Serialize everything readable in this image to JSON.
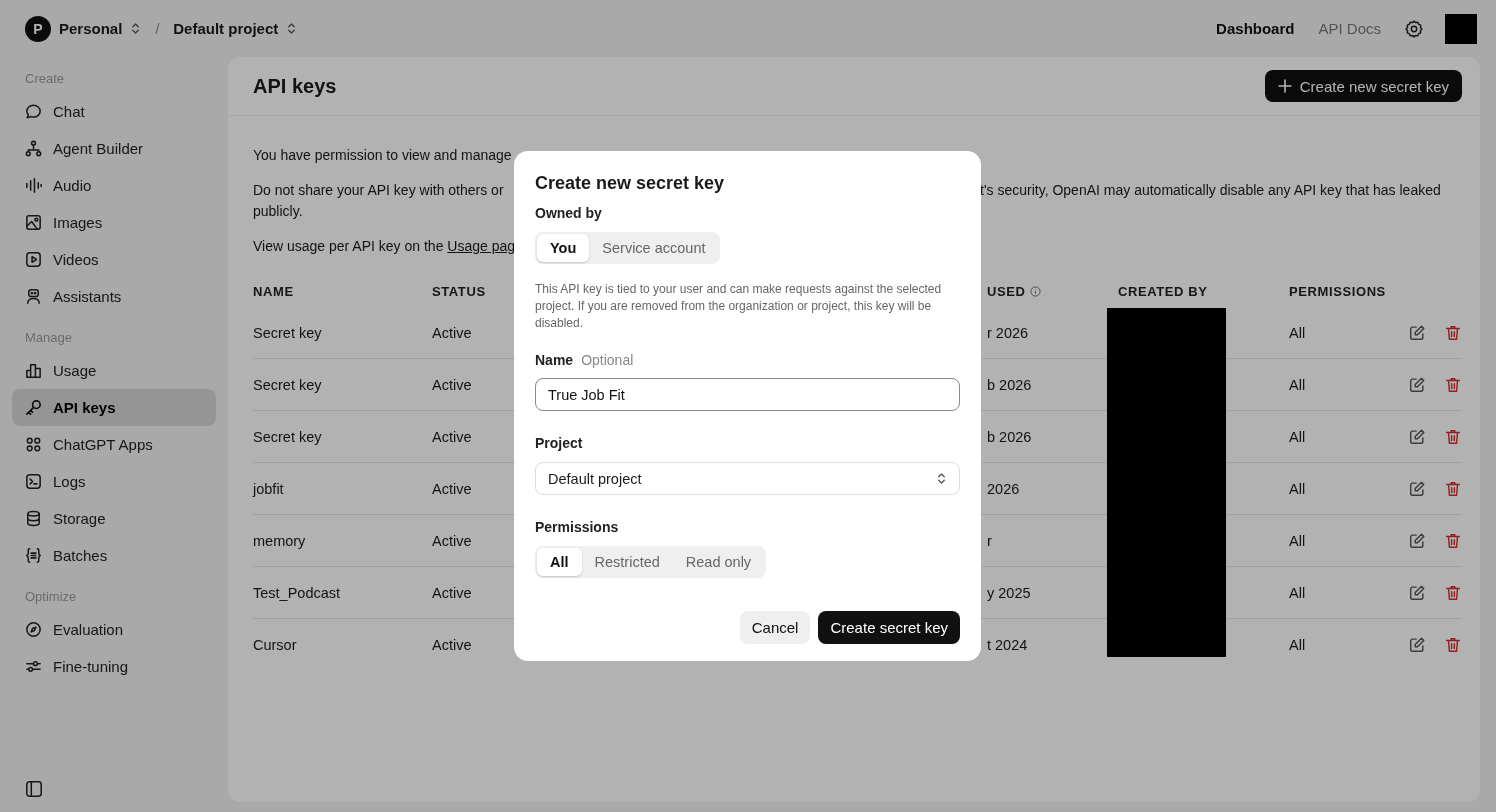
{
  "topbar": {
    "org": {
      "avatar_letter": "P",
      "name": "Personal"
    },
    "separator": "/",
    "project": "Default project",
    "nav": [
      {
        "label": "Dashboard",
        "selected": true
      },
      {
        "label": "API Docs",
        "selected": false
      }
    ]
  },
  "sidebar": {
    "sections": [
      {
        "title": "Create",
        "items": [
          {
            "label": "Chat",
            "kind": "chat",
            "selected": false
          },
          {
            "label": "Agent Builder",
            "kind": "agent",
            "selected": false
          },
          {
            "label": "Audio",
            "kind": "audio",
            "selected": false
          },
          {
            "label": "Images",
            "kind": "images",
            "selected": false
          },
          {
            "label": "Videos",
            "kind": "videos",
            "selected": false
          },
          {
            "label": "Assistants",
            "kind": "assistants",
            "selected": false
          }
        ]
      },
      {
        "title": "Manage",
        "items": [
          {
            "label": "Usage",
            "kind": "usage",
            "selected": false
          },
          {
            "label": "API keys",
            "kind": "key",
            "selected": true
          },
          {
            "label": "ChatGPT Apps",
            "kind": "apps",
            "selected": false
          },
          {
            "label": "Logs",
            "kind": "logs",
            "selected": false
          },
          {
            "label": "Storage",
            "kind": "storage",
            "selected": false
          },
          {
            "label": "Batches",
            "kind": "batches",
            "selected": false
          }
        ]
      },
      {
        "title": "Optimize",
        "items": [
          {
            "label": "Evaluation",
            "kind": "evaluation",
            "selected": false
          },
          {
            "label": "Fine-tuning",
            "kind": "finetuning",
            "selected": false
          }
        ]
      }
    ]
  },
  "page": {
    "title": "API keys",
    "create_button": "Create new secret key",
    "intro": {
      "line_1": "You have permission to view and manage",
      "line_2_left": "Do not share your API key with others or",
      "line_2_right": "t's security, OpenAI may automatically disable any API key that has leaked",
      "line_2_end": "publicly.",
      "line_3": "View usage per API key on the",
      "usage_link": "Usage pag"
    },
    "table": {
      "columns": [
        "NAME",
        "STATUS",
        "USED",
        "CREATED BY",
        "PERMISSIONS"
      ],
      "rows": [
        {
          "name": "Secret key",
          "status": "Active",
          "column_3": "r 2026",
          "permissions": "All"
        },
        {
          "name": "Secret key",
          "status": "Active",
          "column_3": "b 2026",
          "permissions": "All"
        },
        {
          "name": "Secret key",
          "status": "Active",
          "column_3": "b 2026",
          "permissions": "All"
        },
        {
          "name": "jobfit",
          "status": "Active",
          "column_3": "2026",
          "permissions": "All"
        },
        {
          "name": "memory",
          "status": "Active",
          "column_3": "r",
          "permissions": "All"
        },
        {
          "name": "Test_Podcast",
          "status": "Active",
          "column_3": "y 2025",
          "permissions": "All"
        },
        {
          "name": "Cursor",
          "status": "Active",
          "column_3": "t 2024",
          "permissions": "All"
        }
      ]
    }
  },
  "modal": {
    "title": "Create new secret key",
    "owned_by": {
      "label": "Owned by",
      "options": [
        {
          "label": "You",
          "selected": true
        },
        {
          "label": "Service account",
          "selected": false
        }
      ]
    },
    "description": "This API key is tied to your user and can make requests against the selected project. If you are removed from the organization or project, this key will be disabled.",
    "name_field": {
      "label": "Name",
      "hint": "Optional",
      "value": "True Job Fit"
    },
    "project_field": {
      "label": "Project",
      "value": "Default project"
    },
    "permissions": {
      "label": "Permissions",
      "options": [
        {
          "label": "All",
          "selected": true
        },
        {
          "label": "Restricted",
          "selected": false
        },
        {
          "label": "Read only",
          "selected": false
        }
      ]
    },
    "buttons": [
      {
        "label": "Cancel",
        "kind": "secondary"
      },
      {
        "label": "Create secret key",
        "kind": "primary"
      }
    ]
  }
}
